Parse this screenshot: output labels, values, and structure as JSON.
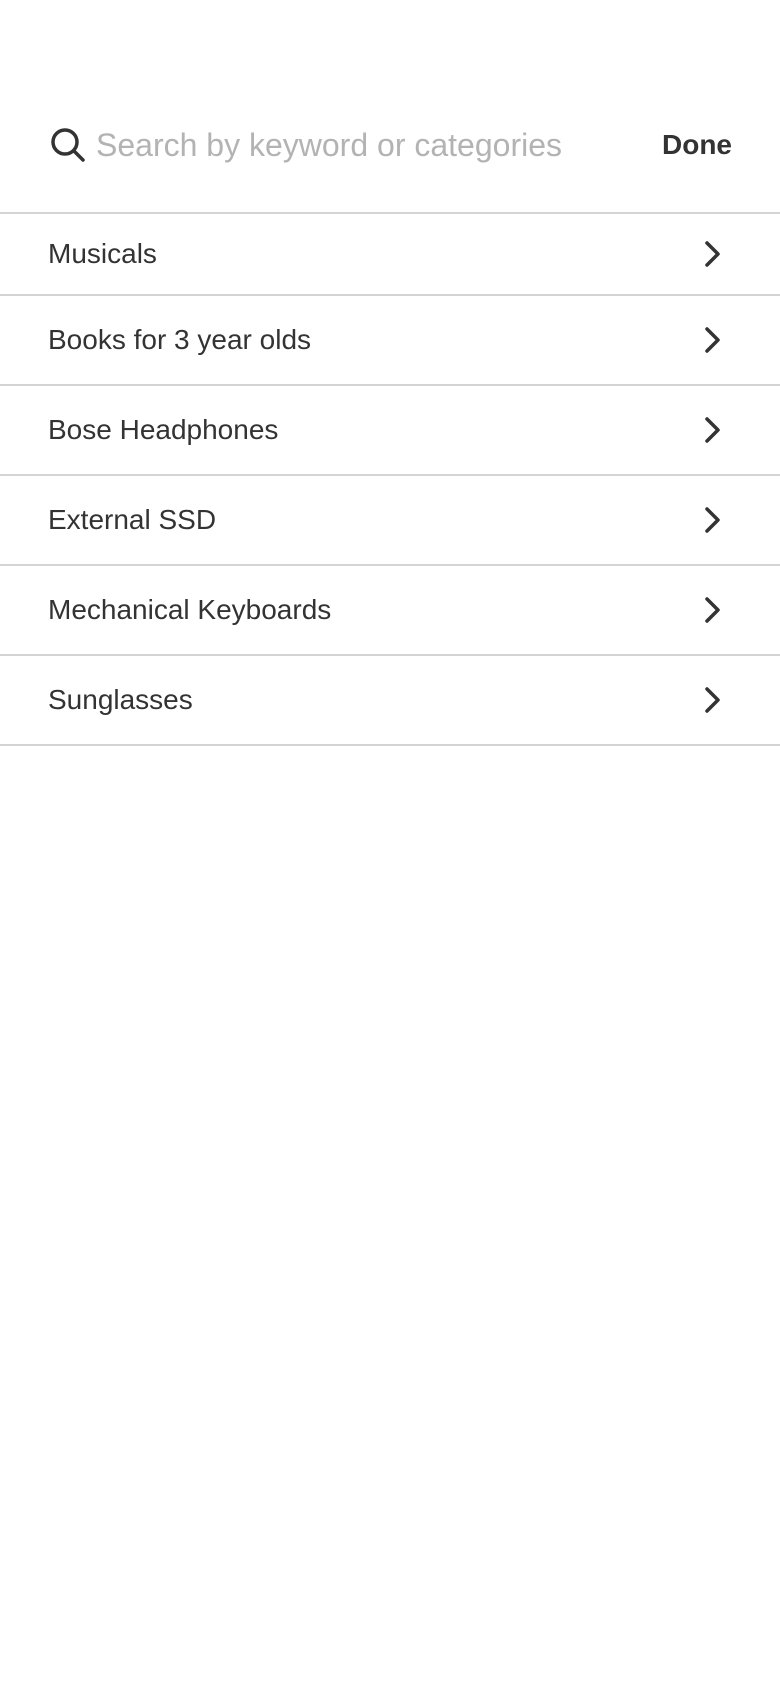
{
  "search": {
    "placeholder": "Search by keyword or categories",
    "value": "",
    "icon": "search-icon",
    "done_label": "Done"
  },
  "suggestions": [
    {
      "label": "Musicals",
      "icon": "chevron-right-icon"
    },
    {
      "label": "Books for 3 year olds",
      "icon": "chevron-right-icon"
    },
    {
      "label": "Bose Headphones",
      "icon": "chevron-right-icon"
    },
    {
      "label": "External SSD",
      "icon": "chevron-right-icon"
    },
    {
      "label": "Mechanical Keyboards",
      "icon": "chevron-right-icon"
    },
    {
      "label": "Sunglasses",
      "icon": "chevron-right-icon"
    }
  ],
  "colors": {
    "text": "#333333",
    "placeholder": "#b3b3b3",
    "divider": "#d4d4d4",
    "background": "#ffffff"
  }
}
